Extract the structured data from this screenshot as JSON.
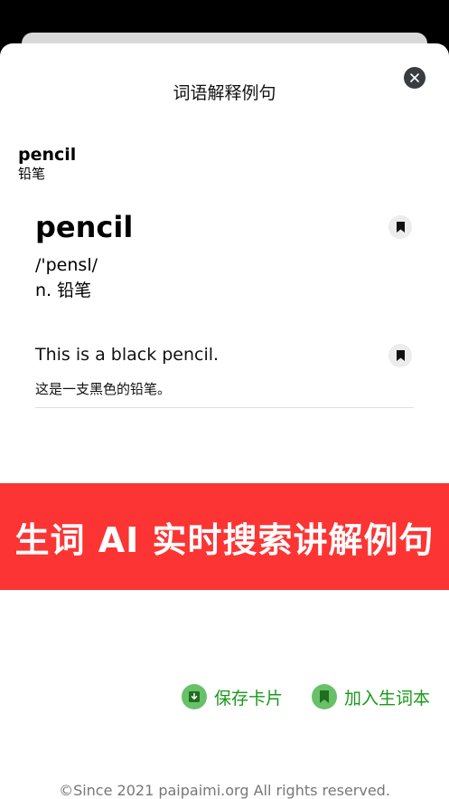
{
  "dialog": {
    "title": "词语解释例句"
  },
  "word_header": {
    "word": "pencil",
    "meaning": "铅笔"
  },
  "entry": {
    "word": "pencil",
    "phonetic": "/'pensl/",
    "definition": "n. 铅笔"
  },
  "example": {
    "en": "This is a black pencil.",
    "zh": "这是一支黑色的铅笔。"
  },
  "banner": {
    "text": "生词 AI 实时搜索讲解例句"
  },
  "actions": {
    "save_label": "保存卡片",
    "add_label": "加入生词本"
  },
  "footer": {
    "copyright": "©Since 2021 paipaimi.org All rights reserved."
  },
  "colors": {
    "banner": "#fc3434",
    "action_green": "#1a9a1a",
    "icon_green": "#68c168"
  },
  "icons": [
    "close-icon",
    "bookmark-icon",
    "download-icon"
  ]
}
